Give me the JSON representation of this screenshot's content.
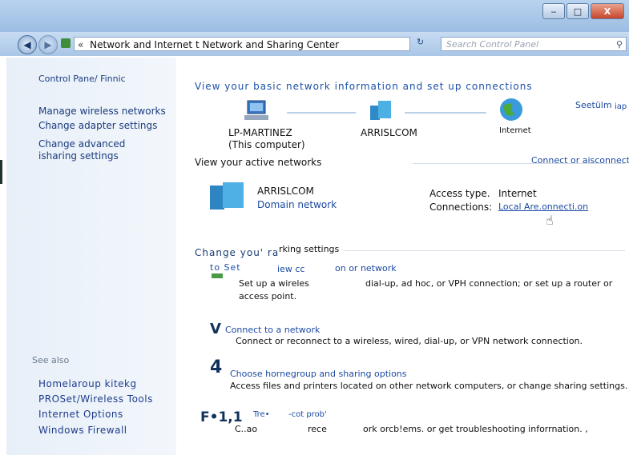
{
  "window": {
    "minimize_label": "‒",
    "maximize_label": "□",
    "close_label": "X"
  },
  "nav": {
    "back_icon": "arrow-left-icon",
    "forward_icon": "arrow-right-icon",
    "address_sep": "«",
    "address_text": "Network and Internet t Network and Sharing Center",
    "refresh_label": "↻",
    "search_placeholder": "Search Control Panel",
    "search_icon": "magnifier"
  },
  "sidebar": {
    "title": "Control Pane/ Finnic",
    "links": [
      "Manage wireless networks",
      "Change adapter settings",
      "Change advanced",
      "isharing settings"
    ],
    "see_also_label": "See also",
    "see_also_links": [
      "Homelaroup kitekg",
      "PROSet/Wireless Tools",
      "Internet Options",
      "Windows Firewall"
    ]
  },
  "main": {
    "heading": "View your basic network information and set up connections",
    "see_full_map": "Seetülm",
    "map_suffix": "iap",
    "computer_name": "LP-MARTINEZ",
    "computer_sub": "(This computer)",
    "router_name": "ARRISLCOM",
    "internet_name": "Internet",
    "active_heading": "View your active networks",
    "connect_link": "Connect or aisconnect",
    "network_name": "ARRISLCOM",
    "network_type": "Domain network",
    "access_type_label": "Access type.",
    "access_type_value": "Internet",
    "connections_label": "Connections:",
    "connections_value": "Local Are.onnecti.on",
    "change_heading_a": "Change you' ra",
    "change_heading_b": "rking settings",
    "item1_a": "to Set",
    "item1_b": "iew cc",
    "item1_c": "on or network",
    "item1_desc_a": "Set up a wireles",
    "item1_desc_b": "dial-up, ad hoc, or VPH connection; or set up a router or",
    "item1_desc_c": "access point.",
    "item2_glyph": "V",
    "item2_link": "Connect to a network",
    "item2_desc": "Connect or reconnect to a wireless, wired, dial-up, or VPN network connection.",
    "item3_glyph": "4",
    "item3_link": "Choose hornegroup and sharing options",
    "item3_desc": "Access files and printers located on other network computers, or change sharing settings.",
    "item4_glyph": "F•1,1",
    "item4_link_a": "Tre•",
    "item4_link_b": "-cot prob'",
    "item4_desc_a": "C..ao",
    "item4_desc_b": "rece",
    "item4_desc_c": "ork orcb!ems. or get troubleshooting inforrnation. ,"
  },
  "colors": {
    "link": "#1d4aa3",
    "sidebar_bg": "#e7eff8",
    "titlebar": "#a9c6e6"
  }
}
